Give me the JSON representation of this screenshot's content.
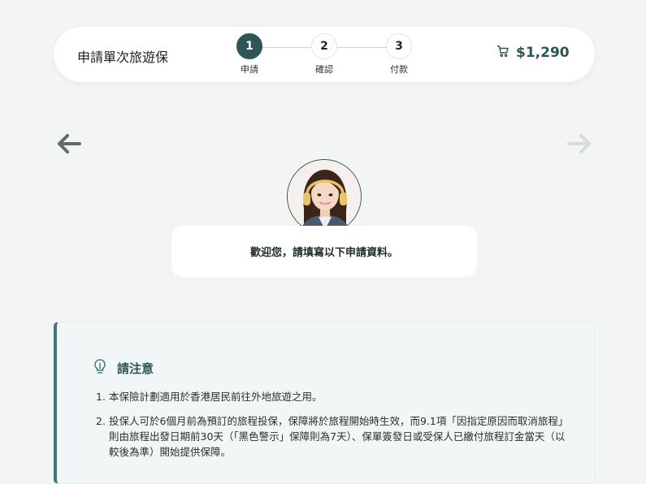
{
  "header": {
    "title": "申請單次旅遊保",
    "steps": [
      {
        "number": "1",
        "label": "申請",
        "active": true
      },
      {
        "number": "2",
        "label": "確認",
        "active": false
      },
      {
        "number": "3",
        "label": "付款",
        "active": false
      }
    ],
    "cart_amount": "$1,290"
  },
  "welcome": {
    "message": "歡迎您，請填寫以下申請資料。"
  },
  "notice": {
    "title": "請注意",
    "items": [
      {
        "num": "1.",
        "text": "本保險計劃適用於香港居民前往外地旅遊之用。"
      },
      {
        "num": "2.",
        "text": "投保人可於6個月前為預訂的旅程投保，保障將於旅程開始時生效，而9.1項「因指定原因而取消旅程」則由旅程出發日期前30天（「黑色警示」保障則為7天）、保單簽發日或受保人已繳付旅程訂金當天（以較後為準）開始提供保障。"
      }
    ]
  },
  "colors": {
    "accent": "#2f5656",
    "notice_border": "#3d7a76",
    "background": "#f3f5f5"
  }
}
